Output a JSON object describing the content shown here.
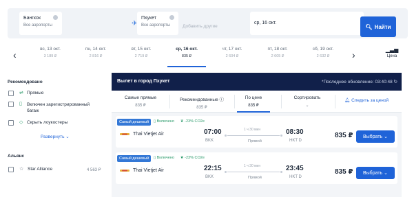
{
  "search": {
    "from_city": "Бангкок",
    "from_sub": "Все аэропорты",
    "to_city": "Пхукет",
    "to_sub": "Все аэропорты",
    "add_placeholder": "Добавить другие",
    "date": "ср, 16 окт.",
    "find_label": "Найти"
  },
  "dates": [
    {
      "day": "вс, 13 окт.",
      "price": "3 189 ₽"
    },
    {
      "day": "пн, 14 окт.",
      "price": "2 816 ₽"
    },
    {
      "day": "вт, 15 окт.",
      "price": "2 719 ₽"
    },
    {
      "day": "ср, 16 окт.",
      "price": "835 ₽"
    },
    {
      "day": "чт, 17 окт.",
      "price": "2 604 ₽"
    },
    {
      "day": "пт, 18 окт.",
      "price": "2 605 ₽"
    },
    {
      "day": "сб, 19 окт.",
      "price": "2 632 ₽"
    }
  ],
  "price_chart_label": "Цена",
  "sidebar": {
    "recommended_title": "Рекомендовано",
    "opt_direct": "Прямые",
    "opt_baggage": "Включен зарегистрированный багаж",
    "opt_lowcost": "Скрыть лоукостеры",
    "expand": "Развернуть",
    "alliance_title": "Альянс",
    "alliance_name": "Star Alliance",
    "alliance_price": "4 563 ₽"
  },
  "panel": {
    "title": "Вылет в город Пхукет",
    "last_update": "*Последнее обновление: 03:40:48",
    "sorts": [
      {
        "label": "Самые прямые",
        "value": "835 ₽"
      },
      {
        "label": "Рекомендованные",
        "value": "835 ₽"
      },
      {
        "label": "По цене",
        "value": "835 ₽"
      },
      {
        "label": "Сортировать",
        "value": ""
      }
    ],
    "track_label": "Следить за ценой"
  },
  "flights": [
    {
      "badge": "Самый дешевый",
      "baggage": "Включено",
      "co2": "-23% CO2e",
      "airline": "Thai Vietjet Air",
      "dep_time": "07:00",
      "dep_airport": "BKK",
      "duration": "1 ч 30 мин",
      "stops": "Прямой",
      "arr_time": "08:30",
      "arr_airport": "HKT D",
      "price": "835 ₽",
      "choose": "Выбрать"
    },
    {
      "badge": "Самый дешевый",
      "baggage": "Включено",
      "co2": "-23% CO2e",
      "airline": "Thai Vietjet Air",
      "dep_time": "22:15",
      "dep_airport": "BKK",
      "duration": "1 ч 30 мин",
      "stops": "Прямой",
      "arr_time": "23:45",
      "arr_airport": "HKT D",
      "price": "835 ₽",
      "choose": "Выбрать"
    }
  ],
  "colors": {
    "accent": "#1f63d8",
    "header_dark": "#11204a",
    "green": "#2a9a6a"
  }
}
